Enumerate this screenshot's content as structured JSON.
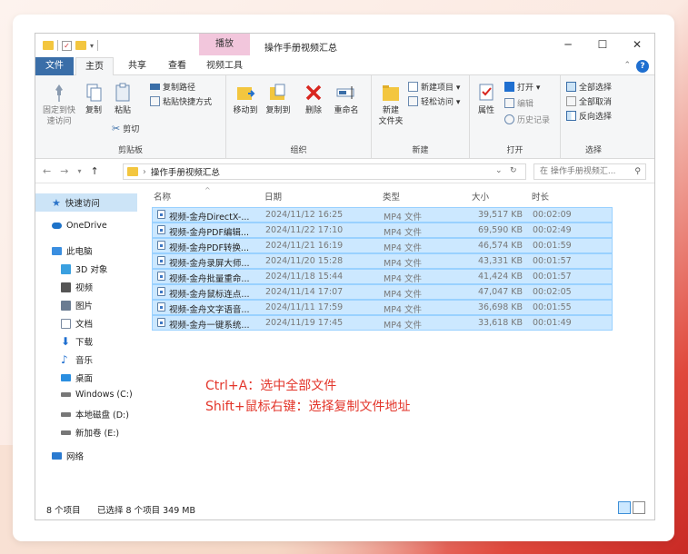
{
  "window": {
    "title": "操作手册视频汇总",
    "play_tab": "播放",
    "ctl_min": "─",
    "ctl_max": "☐",
    "ctl_close": "✕"
  },
  "tabs": {
    "file": "文件",
    "home": "主页",
    "share": "共享",
    "view": "查看",
    "video_tools": "视频工具",
    "help": "?"
  },
  "ribbon": {
    "pin_label": "固定到快\n速访问",
    "copy_label": "复制",
    "paste_label": "粘贴",
    "copy_path": "复制路径",
    "paste_shortcut": "粘贴快捷方式",
    "cut": "剪切",
    "clipboard_group": "剪贴板",
    "move_to": "移动到",
    "copy_to": "复制到",
    "delete": "删除",
    "rename": "重命名",
    "organize_group": "组织",
    "new_folder": "新建\n文件夹",
    "new_item": "新建项目 ▾",
    "easy_access": "轻松访问 ▾",
    "new_group": "新建",
    "properties": "属性",
    "open": "打开 ▾",
    "edit": "编辑",
    "history": "历史记录",
    "open_group": "打开",
    "select_all": "全部选择",
    "select_none": "全部取消",
    "invert_selection": "反向选择",
    "select_group": "选择"
  },
  "address": {
    "back": "←",
    "forward": "→",
    "recent": "▾",
    "up": "↑",
    "path": "操作手册视频汇总",
    "chevron": "›",
    "dropdown": "⌄",
    "refresh": "↻",
    "search_placeholder": "在 操作手册视频汇...",
    "search_icon": "⚲"
  },
  "sidebar": {
    "items": [
      {
        "label": "快速访问",
        "icon": "star-icon",
        "color": "#2b74c9"
      },
      {
        "label": "OneDrive",
        "icon": "cloud-icon",
        "color": "#1e73c9"
      },
      {
        "label": "此电脑",
        "icon": "computer-icon",
        "color": "#3a8ee0"
      },
      {
        "label": "3D 对象",
        "icon": "cube-icon",
        "color": "#3aa0e0"
      },
      {
        "label": "视频",
        "icon": "video-icon",
        "color": "#555555"
      },
      {
        "label": "图片",
        "icon": "pictures-icon",
        "color": "#6a7c92"
      },
      {
        "label": "文档",
        "icon": "documents-icon",
        "color": "#7a8aa0"
      },
      {
        "label": "下载",
        "icon": "downloads-icon",
        "color": "#1f6fd0"
      },
      {
        "label": "音乐",
        "icon": "music-icon",
        "color": "#1f6fd0"
      },
      {
        "label": "桌面",
        "icon": "desktop-icon",
        "color": "#2a8ee0"
      },
      {
        "label": "Windows (C:)",
        "icon": "drive-c-icon",
        "color": "#555555"
      },
      {
        "label": "本地磁盘 (D:)",
        "icon": "drive-d-icon",
        "color": "#555555"
      },
      {
        "label": "新加卷 (E:)",
        "icon": "drive-e-icon",
        "color": "#555555"
      },
      {
        "label": "网络",
        "icon": "network-icon",
        "color": "#2a7ad0"
      }
    ]
  },
  "columns": {
    "name": "名称",
    "date": "日期",
    "type": "类型",
    "size": "大小",
    "length": "时长",
    "sort_indicator": "^"
  },
  "files": [
    {
      "name": "视频-金舟DirectX-...",
      "date": "2024/11/12 16:25",
      "type": "MP4 文件",
      "size": "39,517 KB",
      "length": "00:02:09"
    },
    {
      "name": "视频-金舟PDF编辑...",
      "date": "2024/11/22 17:10",
      "type": "MP4 文件",
      "size": "69,590 KB",
      "length": "00:02:49"
    },
    {
      "name": "视频-金舟PDF转换...",
      "date": "2024/11/21 16:19",
      "type": "MP4 文件",
      "size": "46,574 KB",
      "length": "00:01:59"
    },
    {
      "name": "视频-金舟录屏大师...",
      "date": "2024/11/20 15:28",
      "type": "MP4 文件",
      "size": "43,331 KB",
      "length": "00:01:57"
    },
    {
      "name": "视频-金舟批量重命...",
      "date": "2024/11/18 15:44",
      "type": "MP4 文件",
      "size": "41,424 KB",
      "length": "00:01:57"
    },
    {
      "name": "视频-金舟鼠标连点...",
      "date": "2024/11/14 17:07",
      "type": "MP4 文件",
      "size": "47,047 KB",
      "length": "00:02:05"
    },
    {
      "name": "视频-金舟文字语音...",
      "date": "2024/11/11 17:59",
      "type": "MP4 文件",
      "size": "36,698 KB",
      "length": "00:01:55"
    },
    {
      "name": "视频-金舟一键系统...",
      "date": "2024/11/19 17:45",
      "type": "MP4 文件",
      "size": "33,618 KB",
      "length": "00:01:49"
    }
  ],
  "annotation": {
    "line1": "Ctrl+A：选中全部文件",
    "line2": "Shift+鼠标右键：选择复制文件地址"
  },
  "status": {
    "count": "8 个项目",
    "selected": "已选择 8 个项目  349 MB"
  },
  "colors": {
    "accent": "#3a6ea8",
    "selection": "#cce8ff",
    "annotation": "#e3362b"
  }
}
